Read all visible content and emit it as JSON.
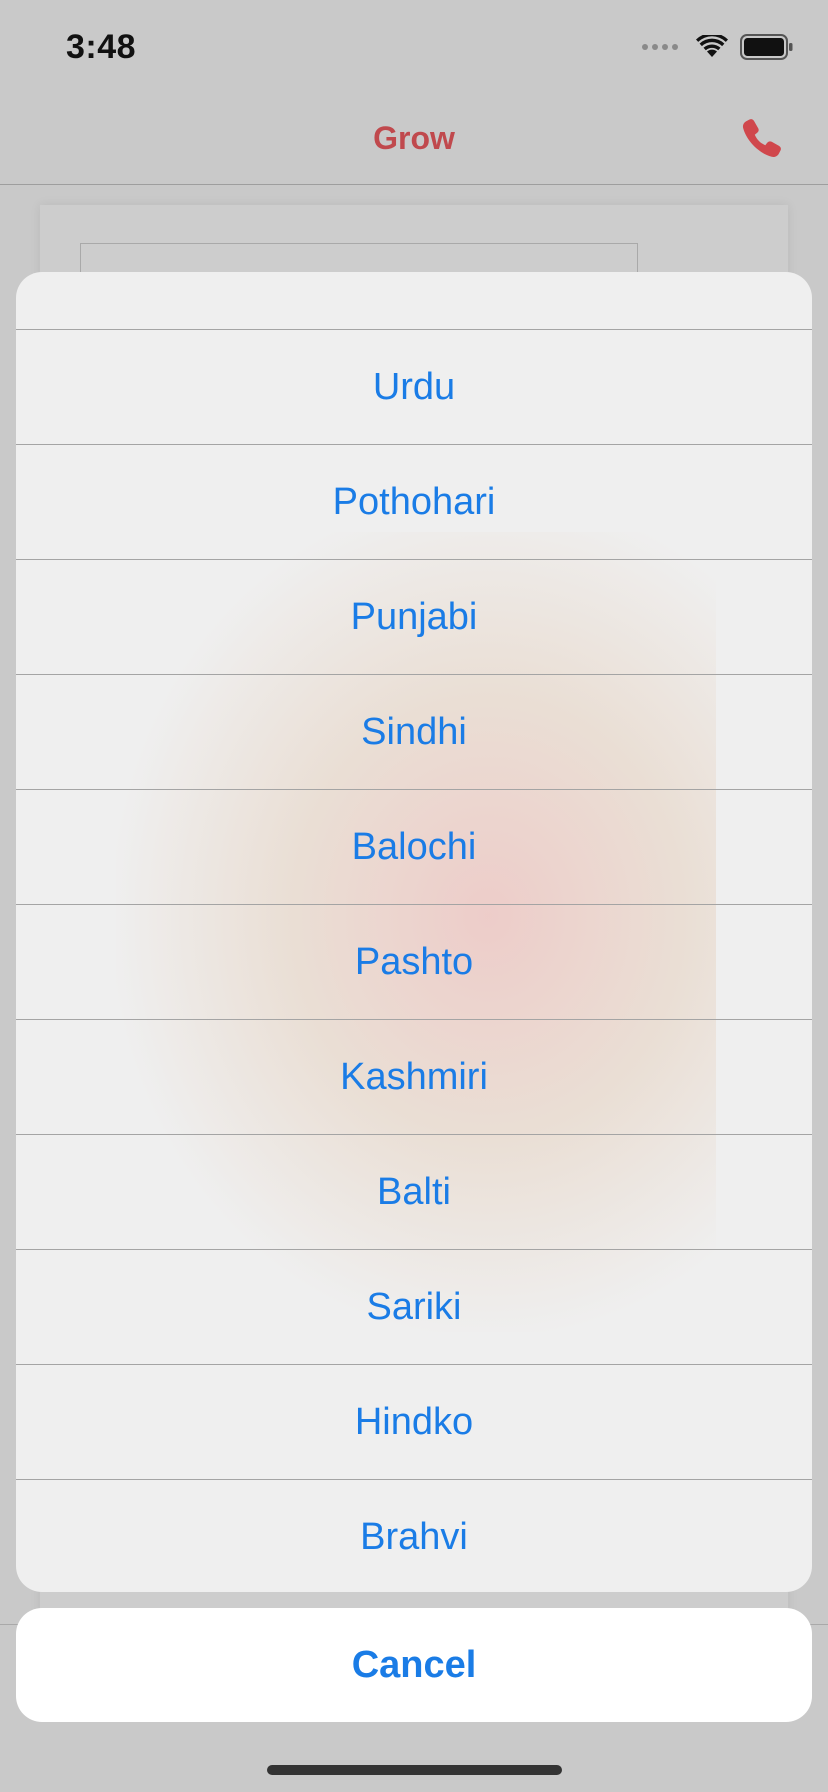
{
  "status_bar": {
    "time": "3:48"
  },
  "nav": {
    "title": "Grow",
    "title_color": "#c0494d",
    "call_icon": "phone-icon"
  },
  "action_sheet": {
    "options": [
      {
        "label": "Urdu"
      },
      {
        "label": "Pothohari"
      },
      {
        "label": "Punjabi"
      },
      {
        "label": "Sindhi"
      },
      {
        "label": "Balochi"
      },
      {
        "label": "Pashto"
      },
      {
        "label": "Kashmiri"
      },
      {
        "label": "Balti"
      },
      {
        "label": "Sariki"
      },
      {
        "label": "Hindko"
      },
      {
        "label": "Brahvi"
      }
    ],
    "cancel_label": "Cancel",
    "accent_color": "#1a7ce6"
  }
}
